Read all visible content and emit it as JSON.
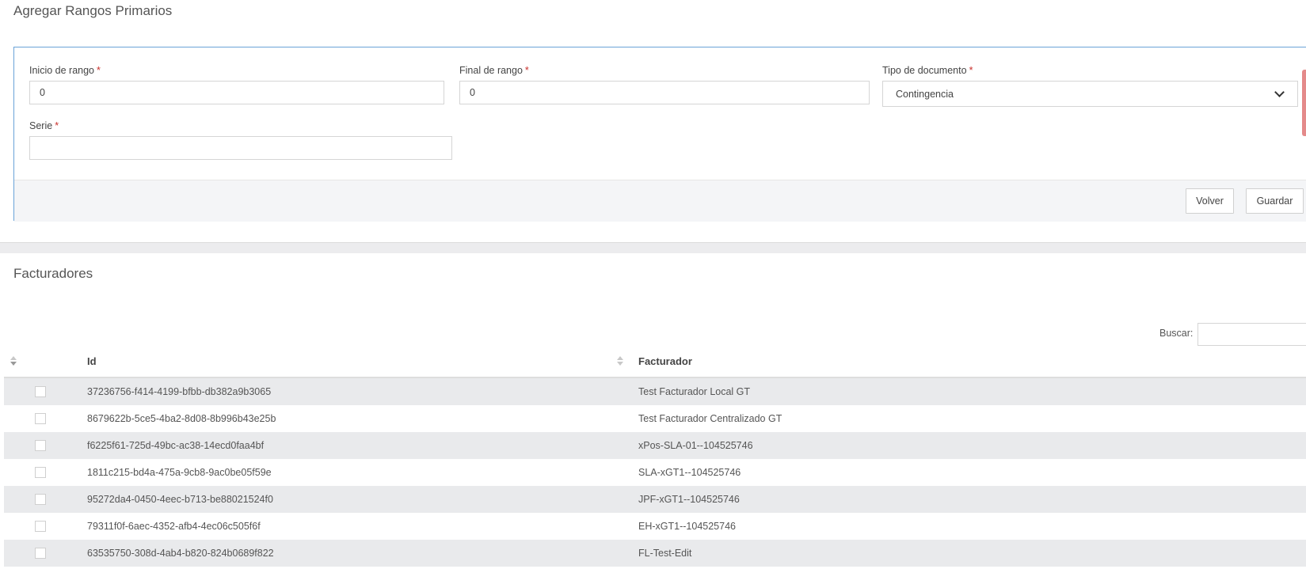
{
  "page_title": "Agregar Rangos Primarios",
  "form": {
    "inicio": {
      "label": "Inicio de rango",
      "required": "*",
      "value": "0"
    },
    "final": {
      "label": "Final de rango",
      "required": "*",
      "value": "0"
    },
    "tipo": {
      "label": "Tipo de documento",
      "required": "*",
      "selected": "Contingencia"
    },
    "serie": {
      "label": "Serie",
      "required": "*",
      "value": ""
    },
    "buttons": {
      "volver": "Volver",
      "guardar": "Guardar"
    }
  },
  "facturadores": {
    "title": "Facturadores",
    "search_label": "Buscar:",
    "search_value": "",
    "columns": {
      "id": "Id",
      "facturador": "Facturador"
    },
    "rows": [
      {
        "id": "37236756-f414-4199-bfbb-db382a9b3065",
        "facturador": "Test Facturador Local GT"
      },
      {
        "id": "8679622b-5ce5-4ba2-8d08-8b996b43e25b",
        "facturador": "Test Facturador Centralizado GT"
      },
      {
        "id": "f6225f61-725d-49bc-ac38-14ecd0faa4bf",
        "facturador": "xPos-SLA-01--104525746"
      },
      {
        "id": "1811c215-bd4a-475a-9cb8-9ac0be05f59e",
        "facturador": "SLA-xGT1--104525746"
      },
      {
        "id": "95272da4-0450-4eec-b713-be88021524f0",
        "facturador": "JPF-xGT1--104525746"
      },
      {
        "id": "79311f0f-6aec-4352-afb4-4ec06c505f6f",
        "facturador": "EH-xGT1--104525746"
      },
      {
        "id": "63535750-308d-4ab4-b820-824b0689f822",
        "facturador": "FL-Test-Edit"
      }
    ]
  },
  "colors": {
    "panel_border": "#6aa3d8",
    "required": "#c9302c",
    "row_striped": "#e9eaec"
  }
}
